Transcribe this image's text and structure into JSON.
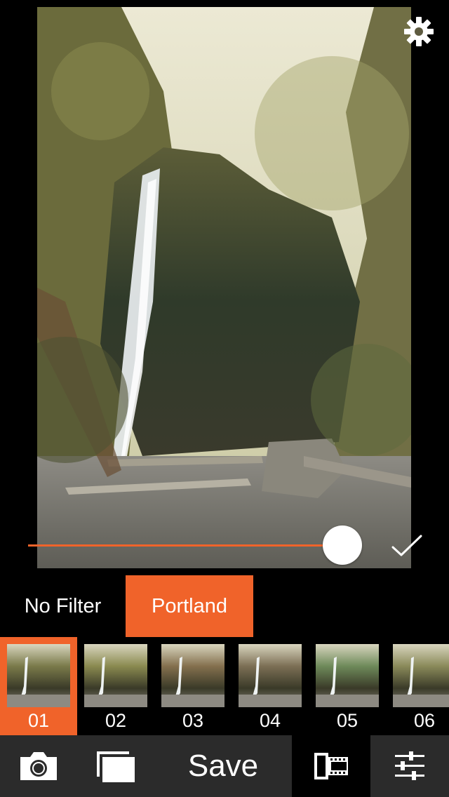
{
  "photo": {
    "alt": "forest waterfall"
  },
  "slider": {
    "value": 0.8
  },
  "filter_categories": [
    {
      "label": "No Filter",
      "active": false
    },
    {
      "label": "Portland",
      "active": true
    }
  ],
  "thumbnails": [
    {
      "label": "01",
      "selected": true,
      "tint": "#7a7a4a"
    },
    {
      "label": "02",
      "selected": false,
      "tint": "#8a8a50"
    },
    {
      "label": "03",
      "selected": false,
      "tint": "#84704e"
    },
    {
      "label": "04",
      "selected": false,
      "tint": "#7c6f55"
    },
    {
      "label": "05",
      "selected": false,
      "tint": "#6e8a5a"
    },
    {
      "label": "06",
      "selected": false,
      "tint": "#8a8a5a"
    }
  ],
  "toolbar": {
    "save_label": "Save"
  },
  "colors": {
    "accent": "#f0632a",
    "toolbar_bg": "#2b2b2b",
    "background": "#000000"
  },
  "icons": {
    "settings": "gear-icon",
    "confirm": "checkmark-icon",
    "camera": "camera-icon",
    "library": "stacked-photos-icon",
    "film": "film-roll-icon",
    "adjust": "sliders-icon"
  }
}
